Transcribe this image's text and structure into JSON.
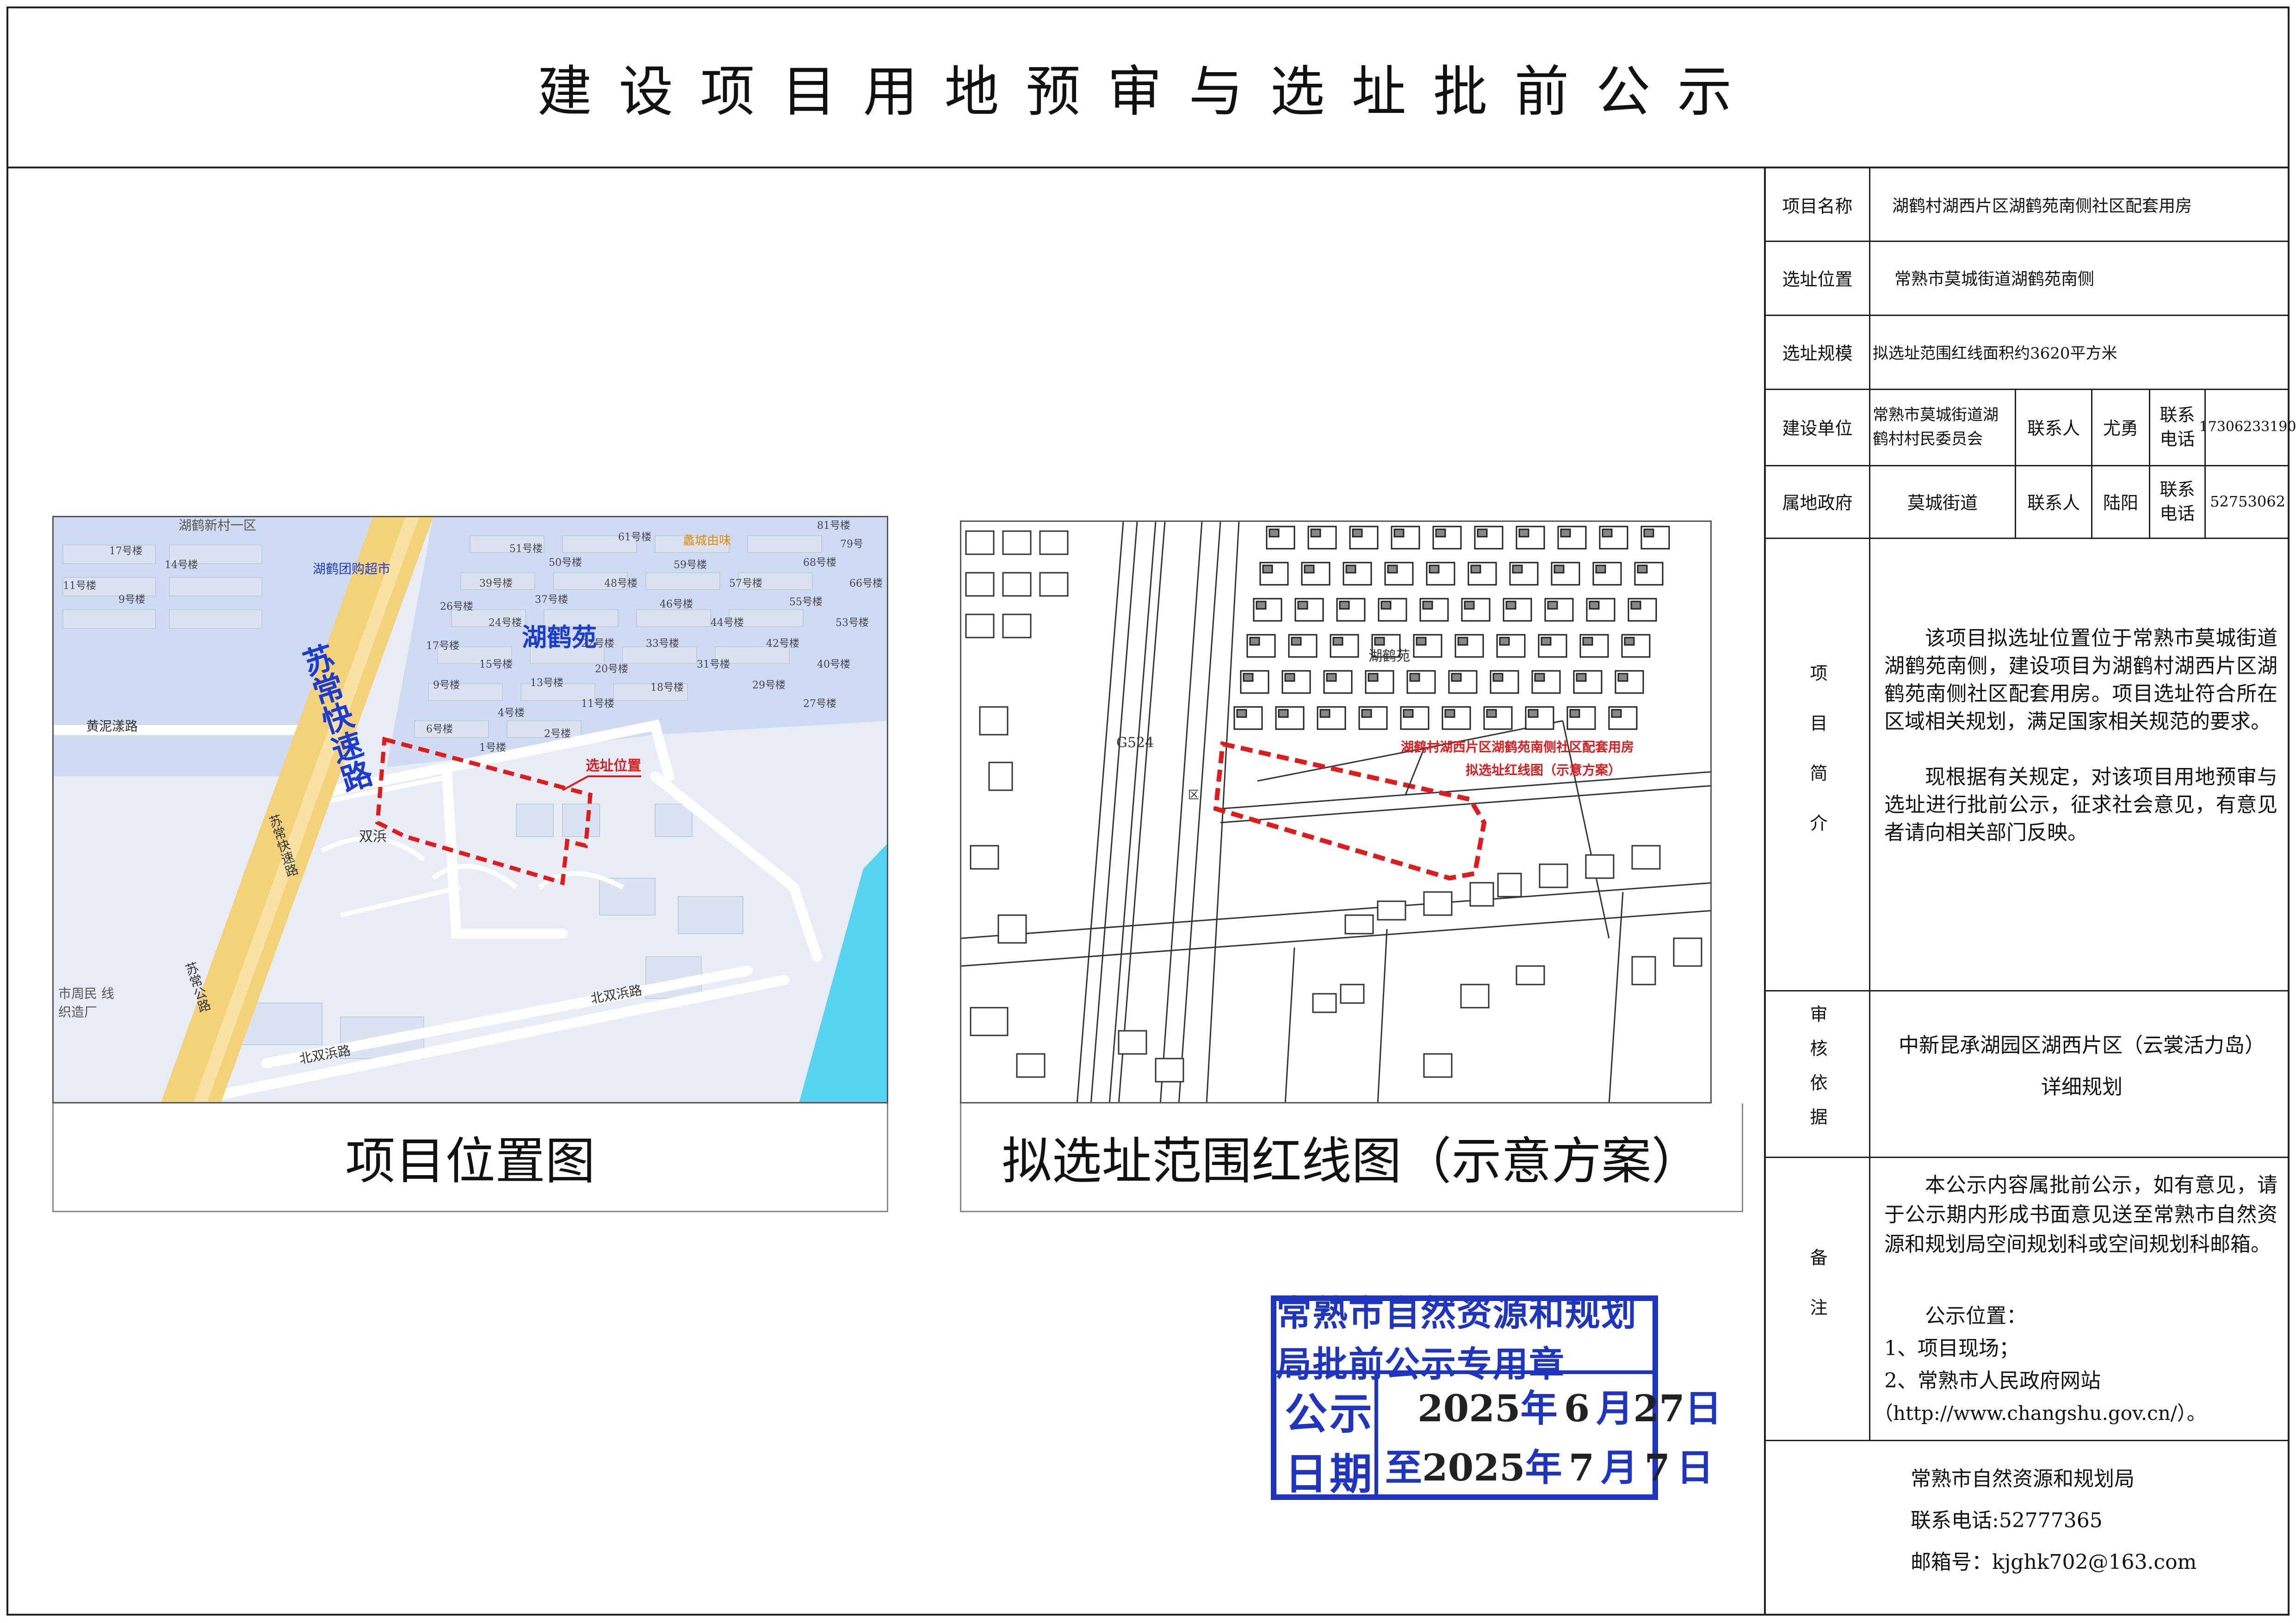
{
  "title": "建设项目用地预审与选址批前公示",
  "table": {
    "project_name_label": "项目名称",
    "project_name": "湖鹤村湖西片区湖鹤苑南侧社区配套用房",
    "location_label": "选址位置",
    "location": "常熟市莫城街道湖鹤苑南侧",
    "scale_label": "选址规模",
    "scale": "拟选址范围红线面积约3620平方米",
    "builder_label": "建设单位",
    "builder": "常熟市莫城街道湖鹤村村民委员会",
    "contact_label": "联系人",
    "builder_contact": "尤勇",
    "phone_label": "联系电话",
    "builder_phone": "17306233190",
    "gov_label": "属地政府",
    "gov": "莫城街道",
    "gov_contact": "陆阳",
    "gov_phone": "52753062",
    "intro_label": "项目简介",
    "intro_p1": "该项目拟选址位置位于常熟市莫城街道湖鹤苑南侧，建设项目为湖鹤村湖西片区湖鹤苑南侧社区配套用房。项目选址符合所在区域相关规划，满足国家相关规范的要求。",
    "intro_p2": "现根据有关规定，对该项目用地预审与选址进行批前公示，征求社会意见，有意见者请向相关部门反映。",
    "basis_label": "审核依据",
    "basis_line1": "中新昆承湖园区湖西片区（云裳活力岛）",
    "basis_line2": "详细规划",
    "remark_label": "备注",
    "remark_p1": "本公示内容属批前公示，如有意见，请于公示期内形成书面意见送至常熟市自然资源和规划局空间规划科或空间规划科邮箱。",
    "remark_p2": "公示位置：",
    "remark_p3": "1、项目现场；",
    "remark_p4": "2、常熟市人民政府网站",
    "remark_p5": "（http://www.changshu.gov.cn/）。",
    "footer_org": "常熟市自然资源和规划局",
    "footer_phone": "联系电话:52777365",
    "footer_email": "邮箱号：kjghk702@163.com"
  },
  "map1": {
    "caption": "项目位置图",
    "labels": {
      "community": "湖鹤苑",
      "expressway": "苏常快速路",
      "expressway_small": "苏常快速路",
      "road_gr": "苏常公路",
      "road_hn": "黄泥漾路",
      "road_bs": "北双浜路",
      "road_bs2": "北双浜路",
      "shuangbang": "双浜",
      "site": "选址位置",
      "poi1": "湖鹤新村一区",
      "poi2": "湖鹤团购超市",
      "poi3": "蠡城由味",
      "poi4": "市周民 线织造厂",
      "b17": "17号楼",
      "b14": "14号楼",
      "b11": "11号楼",
      "b9": "9号楼",
      "b51": "51号楼",
      "b50": "50号楼",
      "b61": "61号楼",
      "b81": "81号楼",
      "b68": "68号楼",
      "b39": "39号楼",
      "b37": "37号楼",
      "b48": "48号楼",
      "b59": "59号楼",
      "b26": "26号楼",
      "b24": "24号楼",
      "b46": "46号楼",
      "b57": "57号楼",
      "b66": "66号楼",
      "b55": "55号楼",
      "b44": "44号楼",
      "b53": "53号楼",
      "b33": "33号楼",
      "b42": "42号楼",
      "b17b": "17号楼",
      "b15": "15号楼",
      "b22": "22号楼",
      "b31": "31号楼",
      "b40": "40号楼",
      "b13": "13号楼",
      "b20": "20号楼",
      "b29": "29号楼",
      "b9b": "9号楼",
      "b11b": "11号楼",
      "b18": "18号楼",
      "b27": "27号楼",
      "b6": "6号楼",
      "b4": "4号楼",
      "b2": "2号楼",
      "b1": "1号楼",
      "b79": "79号"
    }
  },
  "map2": {
    "caption": "拟选址范围红线图（示意方案）",
    "labels": {
      "community": "湖鹤苑",
      "road": "G524",
      "road2": "区",
      "site_line1": "湖鹤村湖西片区湖鹤苑南侧社区配套用房",
      "site_line2": "拟选址红线图（示意方案）"
    }
  },
  "stamp": {
    "header": "常熟市自然资源和规划局批前公示专用章",
    "gong": "公",
    "shi": "示",
    "ri": "日",
    "qi": "期",
    "row1_pre": "",
    "y1": "2025",
    "nian": "年",
    "m1": "6",
    "yue": "月",
    "d1": "27",
    "ri_c": "日",
    "zhi": "至",
    "y2": "2025",
    "m2": "7",
    "d2": "7"
  },
  "colors": {
    "stamp_blue": "#1d35c0",
    "red": "#e01b1b",
    "road_yellow": "#f3d27a",
    "water": "#55d3f0"
  }
}
